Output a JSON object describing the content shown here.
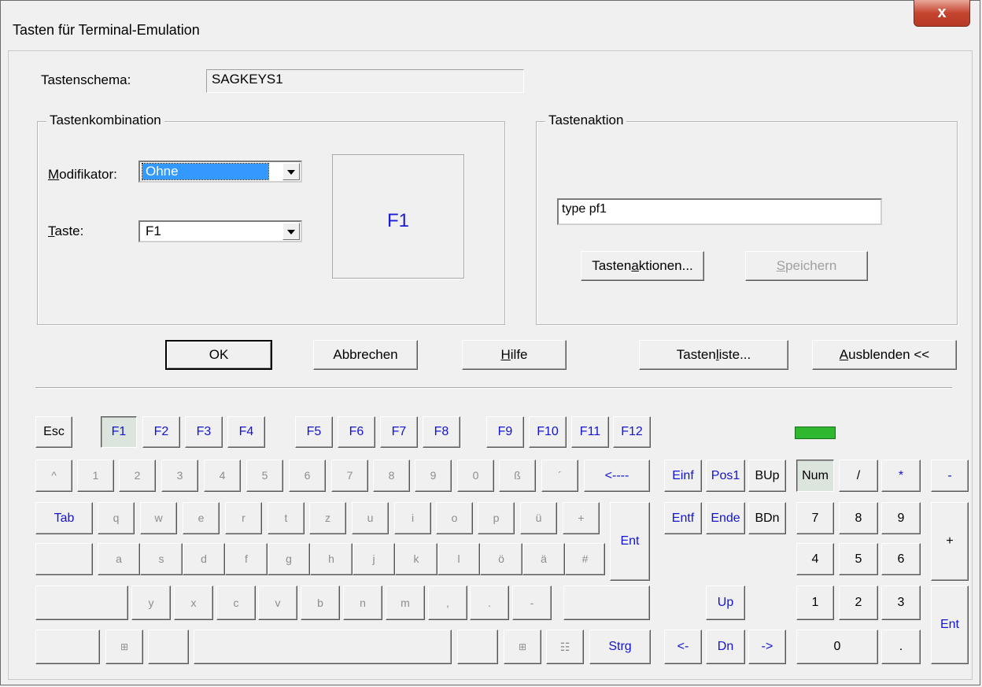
{
  "window": {
    "title": "Tasten für Terminal-Emulation",
    "close_label": "x"
  },
  "schema": {
    "label": "Tastenschema:",
    "value": "SAGKEYS1"
  },
  "kombination": {
    "title": "Tastenkombination",
    "modifikator_label": "Modifikator:",
    "modifikator_value": "Ohne",
    "taste_label": "Taste:",
    "taste_value": "F1",
    "preview": "F1"
  },
  "aktion": {
    "title": "Tastenaktion",
    "value": "type pf1",
    "tastenaktionen_button": "Tastenaktionen...",
    "speichern_button": "Speichern"
  },
  "buttons": {
    "ok": "OK",
    "abbrechen": "Abbrechen",
    "hilfe": "Hilfe",
    "tastenliste": "Tastenliste...",
    "ausblenden": "Ausblenden <<"
  },
  "colors": {
    "key_blue": "#1414d2",
    "led_green": "#2fb82f",
    "key_grey": "#8d8d8d"
  },
  "keyboard": {
    "fkeys": [
      "Esc",
      "F1",
      "F2",
      "F3",
      "F4",
      "F5",
      "F6",
      "F7",
      "F8",
      "F9",
      "F10",
      "F11",
      "F12"
    ],
    "row1": [
      "^",
      "1",
      "2",
      "3",
      "4",
      "5",
      "6",
      "7",
      "8",
      "9",
      "0",
      "ß",
      "´",
      "<----"
    ],
    "row2": [
      "Tab",
      "q",
      "w",
      "e",
      "r",
      "t",
      "z",
      "u",
      "i",
      "o",
      "p",
      "ü",
      "+",
      "Ent"
    ],
    "row3": [
      "",
      "a",
      "s",
      "d",
      "f",
      "g",
      "h",
      "j",
      "k",
      "l",
      "ö",
      "ä",
      "#"
    ],
    "row4": [
      "",
      "y",
      "x",
      "c",
      "v",
      "b",
      "n",
      "m",
      ",",
      ".",
      "-",
      ""
    ],
    "row5_labels": [
      "Strg"
    ],
    "nav": [
      "Einf",
      "Pos1",
      "BUp",
      "Entf",
      "Ende",
      "BDn",
      "Up",
      "<-",
      "Dn",
      "->"
    ],
    "numpad": [
      "Num",
      "/",
      "*",
      "-",
      "7",
      "8",
      "9",
      "+",
      "4",
      "5",
      "6",
      "1",
      "2",
      "3",
      "Ent",
      "0",
      "."
    ]
  }
}
